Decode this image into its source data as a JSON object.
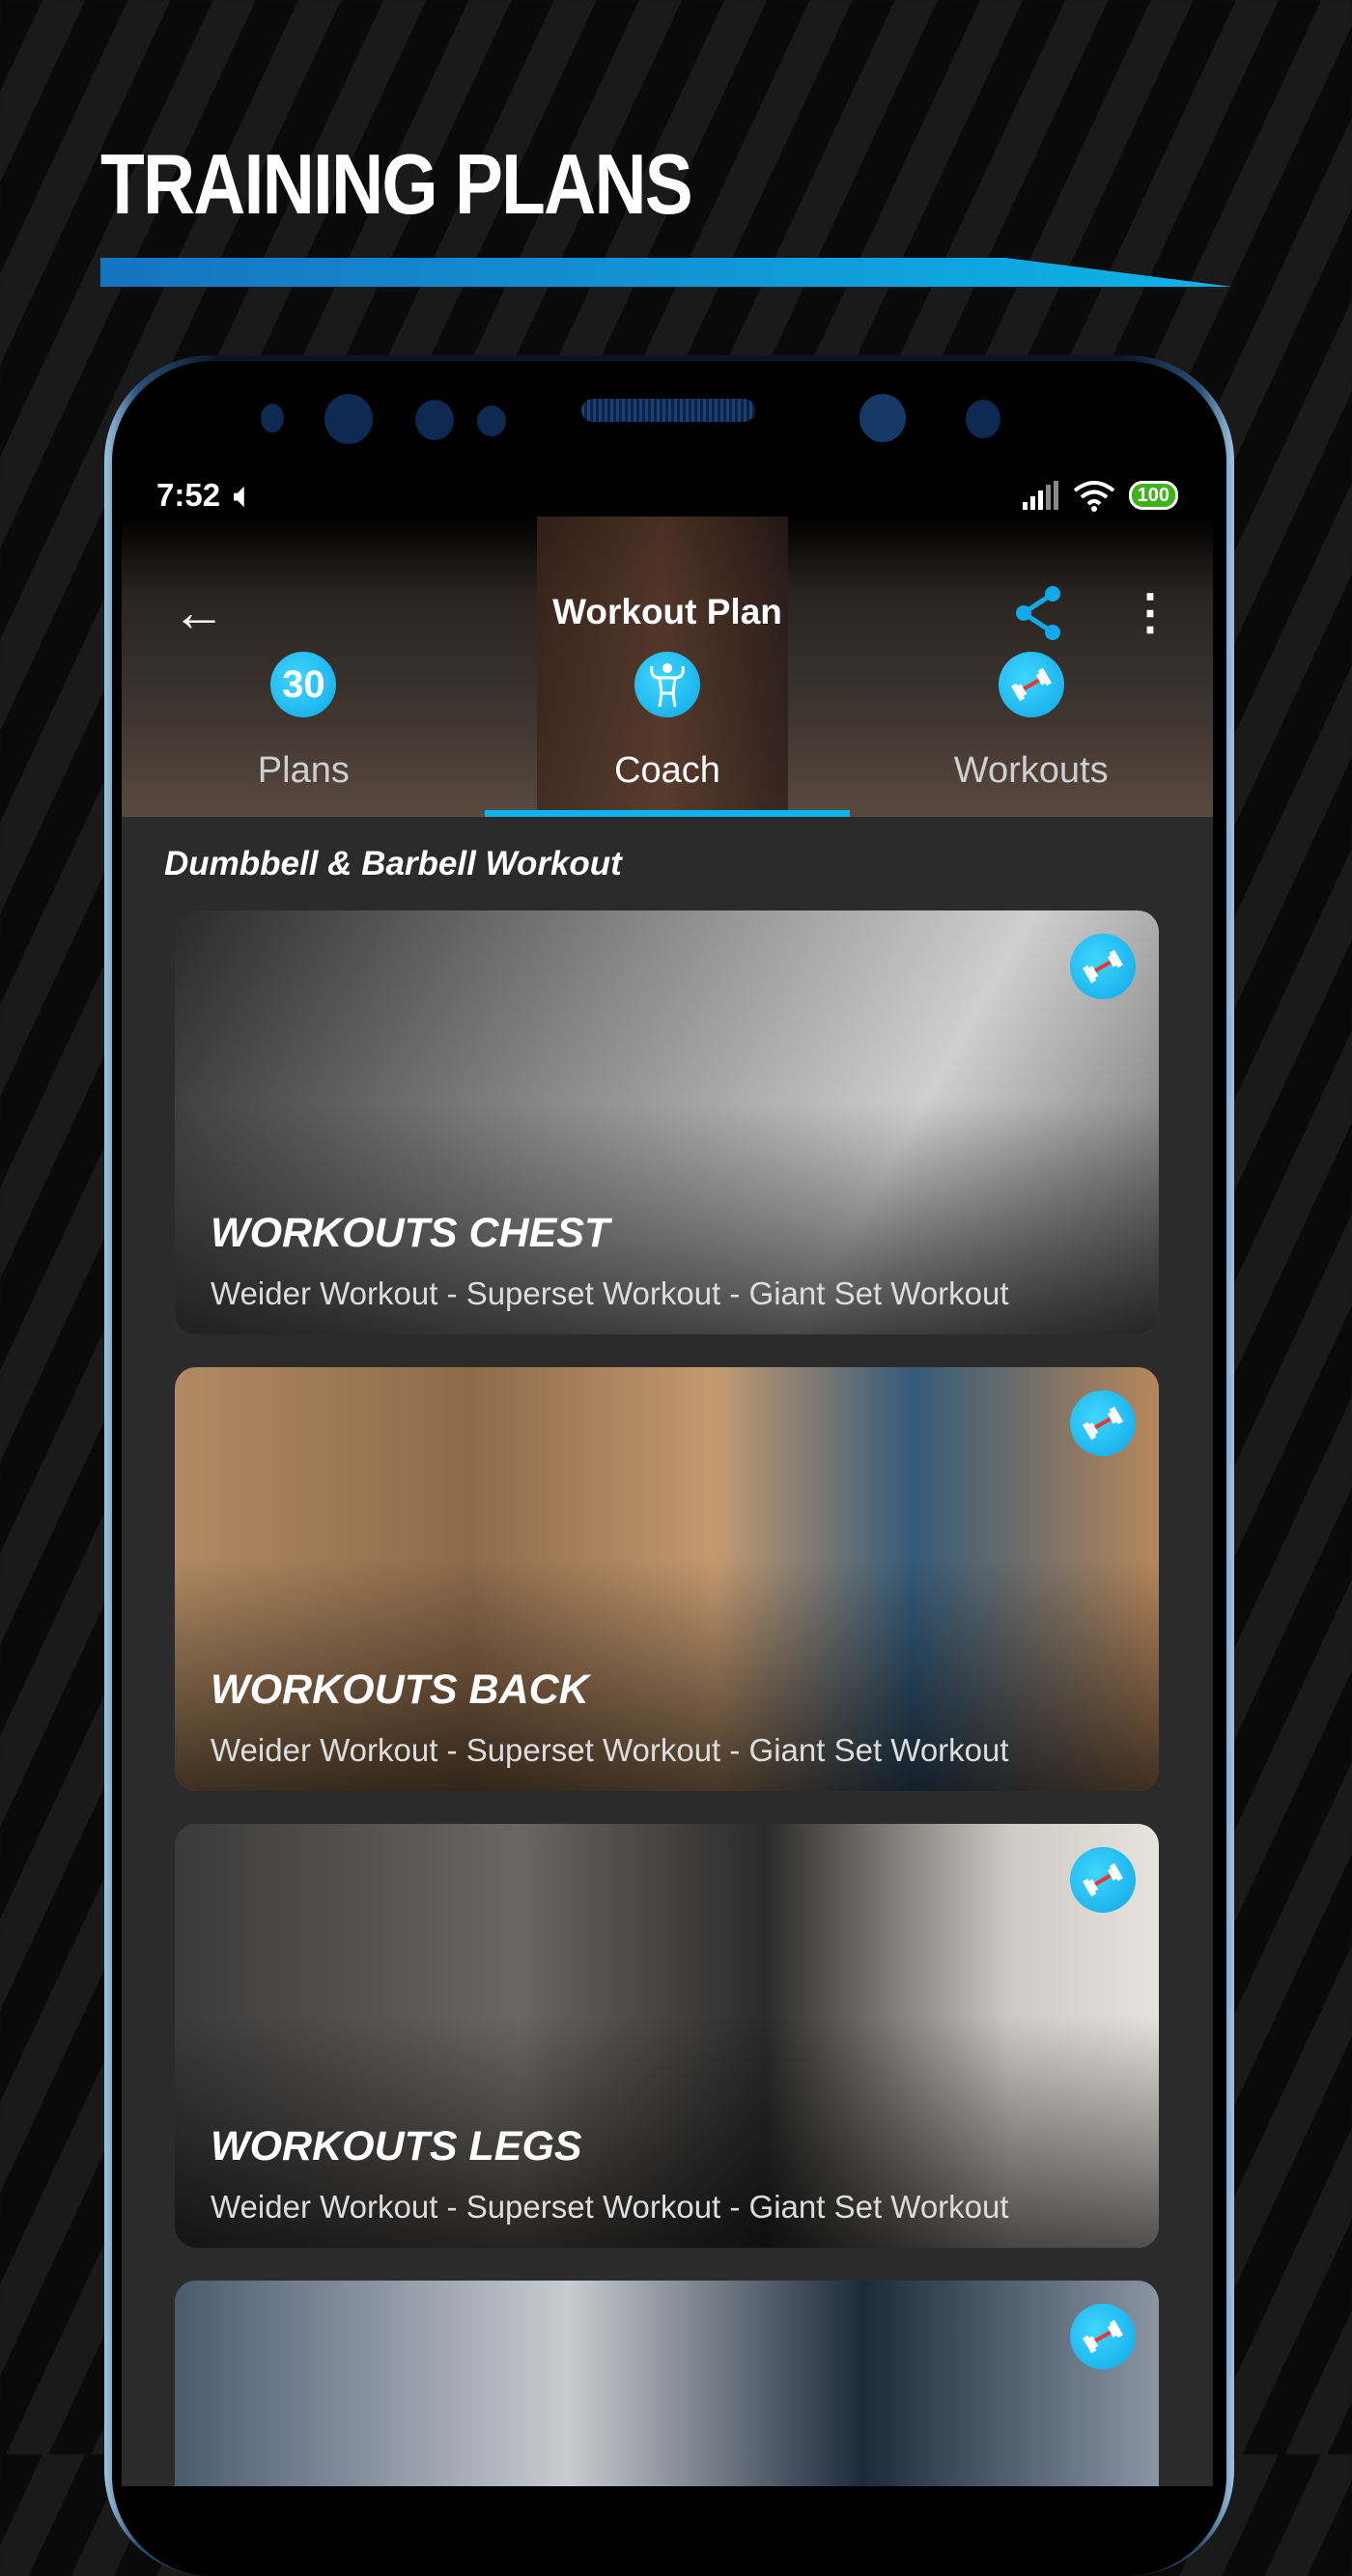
{
  "headline": "TRAINING PLANS",
  "status": {
    "time": "7:52",
    "battery": "100"
  },
  "toolbar": {
    "title": "Workout Plan"
  },
  "tabs": [
    {
      "label": "Plans",
      "icon_text": "30"
    },
    {
      "label": "Coach",
      "icon": "bodybuilder-icon"
    },
    {
      "label": "Workouts",
      "icon": "dumbbell-icon"
    }
  ],
  "active_tab": "Coach",
  "section_title": "Dumbbell & Barbell Workout",
  "cards": [
    {
      "title": "WORKOUTS CHEST",
      "subtitle": "Weider Workout - Superset Workout - Giant Set Workout"
    },
    {
      "title": "WORKOUTS BACK",
      "subtitle": "Weider Workout - Superset Workout - Giant Set Workout"
    },
    {
      "title": "WORKOUTS LEGS",
      "subtitle": "Weider Workout - Superset Workout - Giant Set Workout"
    },
    {
      "title": "",
      "subtitle": ""
    }
  ],
  "colors": {
    "accent": "#0db4f0",
    "background": "#2b2b2b"
  }
}
